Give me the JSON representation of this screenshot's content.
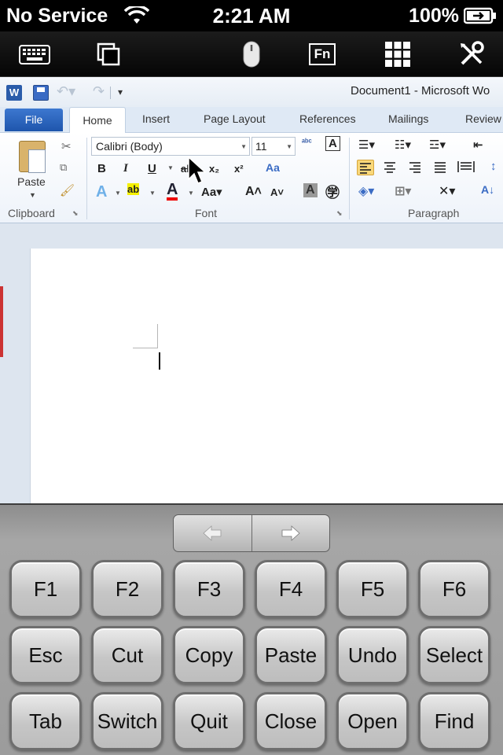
{
  "status_bar": {
    "carrier": "No Service",
    "time": "2:21 AM",
    "battery": "100%",
    "icons": [
      "wifi-icon",
      "battery-charging-icon"
    ]
  },
  "toolbar": {
    "icons": [
      "keyboard-icon",
      "windows-icon",
      "mouse-icon",
      "fn-icon",
      "grid-icon",
      "tools-icon"
    ],
    "fn_label": "Fn"
  },
  "word": {
    "logo_letter": "W",
    "title": "Document1 - Microsoft Wo",
    "tabs": [
      "File",
      "Home",
      "Insert",
      "Page Layout",
      "References",
      "Mailings",
      "Review"
    ],
    "clipboard": {
      "paste_label": "Paste",
      "group_label": "Clipboard"
    },
    "font": {
      "font_name": "Calibri (Body)",
      "font_size": "11",
      "group_label": "Font"
    },
    "paragraph": {
      "group_label": "Paragraph"
    }
  },
  "keyboard": {
    "arrows": {
      "left": "left-arrow-icon",
      "right": "right-arrow-icon"
    },
    "rows": [
      [
        "F1",
        "F2",
        "F3",
        "F4",
        "F5",
        "F6"
      ],
      [
        "Esc",
        "Cut",
        "Copy",
        "Paste",
        "Undo",
        "Select"
      ],
      [
        "Tab",
        "Switch",
        "Quit",
        "Close",
        "Open",
        "Find"
      ]
    ]
  }
}
